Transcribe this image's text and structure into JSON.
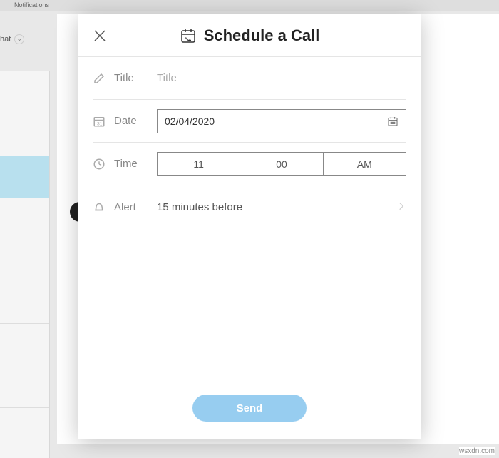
{
  "background": {
    "notifications_label": "Notifications",
    "chat_label": "hat"
  },
  "modal": {
    "title": "Schedule a Call",
    "close_label": "Close"
  },
  "fields": {
    "title": {
      "label": "Title",
      "placeholder": "Title",
      "value": ""
    },
    "date": {
      "label": "Date",
      "value": "02/04/2020"
    },
    "time": {
      "label": "Time",
      "hour": "11",
      "minute": "00",
      "period": "AM"
    },
    "alert": {
      "label": "Alert",
      "value": "15 minutes before"
    }
  },
  "actions": {
    "send": "Send"
  },
  "watermark": "wsxdn.com"
}
